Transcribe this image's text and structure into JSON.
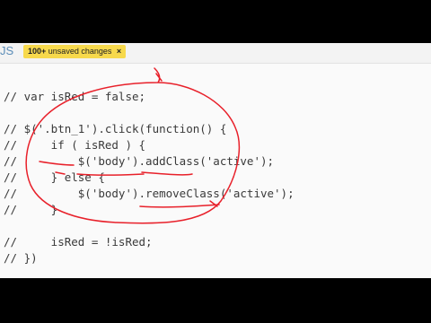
{
  "editor": {
    "language_label": "JS",
    "unsaved": {
      "count": "100+",
      "text": "unsaved changes",
      "close_icon": "×"
    }
  },
  "code_lines": [
    "// var isRed = false;",
    "",
    "// $('.btn_1').click(function() {",
    "//     if ( isRed ) {",
    "//         $('body').addClass('active');",
    "//     } else {",
    "//         $('body').removeClass('active');",
    "//     }",
    "",
    "//     isRed = !isRed;",
    "// })"
  ],
  "annotation_color": "#e8202a"
}
